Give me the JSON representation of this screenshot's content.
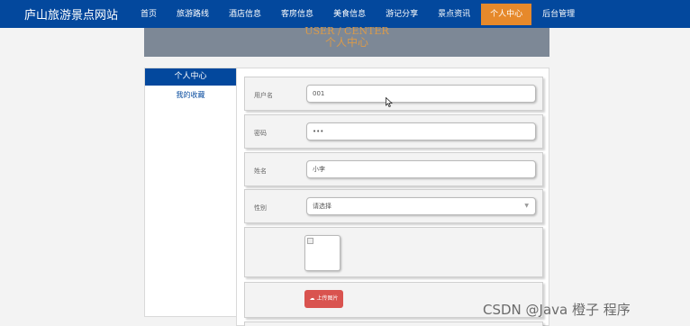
{
  "site": {
    "title": "庐山旅游景点网站"
  },
  "nav": [
    {
      "label": "首页",
      "active": false
    },
    {
      "label": "旅游路线",
      "active": false
    },
    {
      "label": "酒店信息",
      "active": false
    },
    {
      "label": "客房信息",
      "active": false
    },
    {
      "label": "美食信息",
      "active": false
    },
    {
      "label": "游记分享",
      "active": false
    },
    {
      "label": "景点资讯",
      "active": false
    },
    {
      "label": "个人中心",
      "active": true
    },
    {
      "label": "后台管理",
      "active": false
    }
  ],
  "banner": {
    "title_en": "USER / CENTER",
    "title_cn": "个人中心"
  },
  "sidebar": {
    "heading": "个人中心",
    "items": [
      {
        "label": "我的收藏"
      }
    ]
  },
  "form": {
    "username": {
      "label": "用户名",
      "value": "001"
    },
    "password": {
      "label": "密码",
      "value": "•••"
    },
    "name": {
      "label": "姓名",
      "value": "小李"
    },
    "gender": {
      "label": "性别",
      "value": "请选择"
    },
    "upload_label": "上传图片"
  },
  "watermark": "CSDN @Java  橙子  程序",
  "colors": {
    "nav_bg": "#03489d",
    "active_nav": "#e6892b",
    "upload_btn": "#d9534f"
  }
}
